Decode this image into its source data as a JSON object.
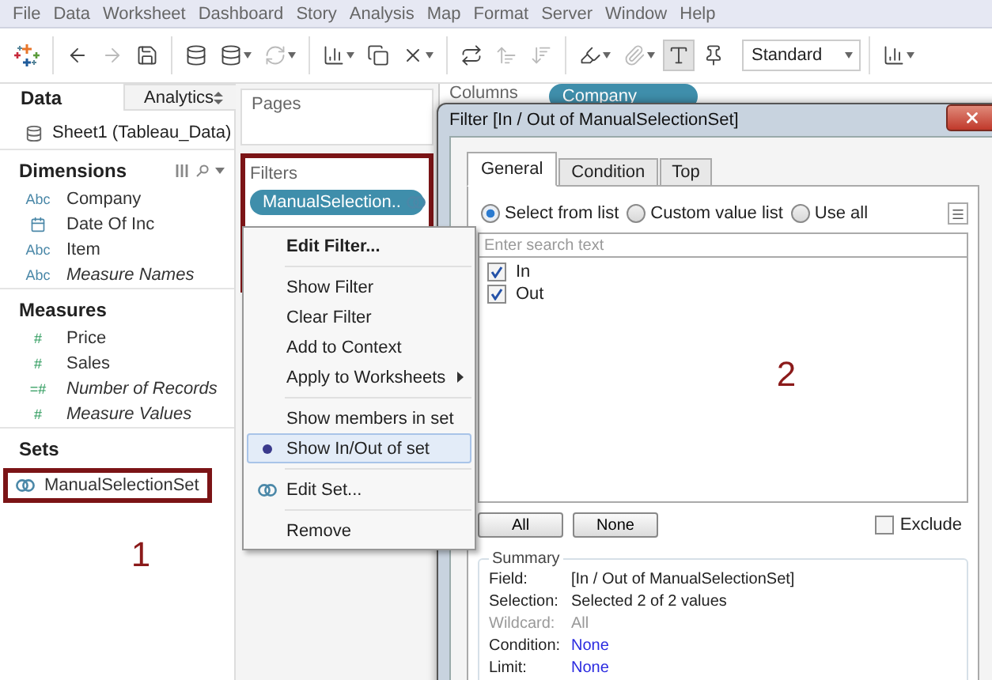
{
  "menu_bar": [
    "File",
    "Data",
    "Worksheet",
    "Dashboard",
    "Story",
    "Analysis",
    "Map",
    "Format",
    "Server",
    "Window",
    "Help"
  ],
  "toolbar": {
    "items": [
      {
        "kind": "logo",
        "disabled": false,
        "selected": false,
        "dropdown": false
      },
      {
        "kind": "separator"
      },
      {
        "kind": "back",
        "disabled": false,
        "selected": false,
        "dropdown": false
      },
      {
        "kind": "forward",
        "disabled": true,
        "selected": false,
        "dropdown": false
      },
      {
        "kind": "save",
        "disabled": false,
        "selected": false,
        "dropdown": false
      },
      {
        "kind": "separator"
      },
      {
        "kind": "new-data-source",
        "disabled": false,
        "selected": false,
        "dropdown": false
      },
      {
        "kind": "pause-updates",
        "disabled": false,
        "selected": false,
        "dropdown": true
      },
      {
        "kind": "refresh",
        "disabled": true,
        "selected": false,
        "dropdown": true
      },
      {
        "kind": "separator"
      },
      {
        "kind": "new-sheet",
        "disabled": false,
        "selected": false,
        "dropdown": true
      },
      {
        "kind": "duplicate",
        "disabled": false,
        "selected": false,
        "dropdown": false
      },
      {
        "kind": "clear-sheet",
        "disabled": false,
        "selected": false,
        "dropdown": true
      },
      {
        "kind": "separator"
      },
      {
        "kind": "swap",
        "disabled": false,
        "selected": false,
        "dropdown": false
      },
      {
        "kind": "sort-ascending",
        "disabled": true,
        "selected": false,
        "dropdown": false
      },
      {
        "kind": "sort-descending",
        "disabled": true,
        "selected": false,
        "dropdown": false
      },
      {
        "kind": "separator"
      },
      {
        "kind": "highlight",
        "disabled": false,
        "selected": false,
        "dropdown": true
      },
      {
        "kind": "annotate",
        "disabled": true,
        "selected": false,
        "dropdown": true
      },
      {
        "kind": "labels",
        "disabled": false,
        "selected": true,
        "dropdown": false
      },
      {
        "kind": "pin",
        "disabled": false,
        "selected": false,
        "dropdown": false
      }
    ],
    "fit": "Standard",
    "show_me_dropdown": true
  },
  "data_pane": {
    "tabs": [
      {
        "label": "Data",
        "selected": true
      },
      {
        "label": "Analytics",
        "selected": false
      }
    ],
    "data_source": "Sheet1 (Tableau_Data)",
    "sections": [
      {
        "title": "Dimensions",
        "fields": [
          {
            "kind": "text",
            "badge": "Abc",
            "name": "Company",
            "generated": false
          },
          {
            "kind": "date",
            "name": "Date Of Inc",
            "generated": false
          },
          {
            "kind": "text",
            "badge": "Abc",
            "name": "Item",
            "generated": false
          },
          {
            "kind": "text",
            "badge": "Abc",
            "name": "Measure Names",
            "generated": true
          }
        ]
      },
      {
        "title": "Measures",
        "fields": [
          {
            "kind": "number",
            "badge": "#",
            "name": "Price",
            "generated": false
          },
          {
            "kind": "number",
            "badge": "#",
            "name": "Sales",
            "generated": false
          },
          {
            "kind": "number",
            "badge": "=#",
            "name": "Number of Records",
            "generated": true
          },
          {
            "kind": "number",
            "badge": "#",
            "name": "Measure Values",
            "generated": true
          }
        ]
      },
      {
        "title": "Sets",
        "fields": [
          {
            "kind": "set",
            "name": "ManualSelectionSet",
            "generated": false,
            "highlighted": true
          }
        ]
      }
    ],
    "annotation": "1"
  },
  "pages_shelf": {
    "title": "Pages"
  },
  "filters_shelf": {
    "title": "Filters",
    "highlighted": true,
    "pills": [
      "ManualSelection.."
    ]
  },
  "columns_shelf": {
    "label": "Columns",
    "pills": [
      "Company"
    ]
  },
  "context_menu": {
    "items": [
      {
        "kind": "item",
        "label": "Edit Filter...",
        "bold": true,
        "checked": false,
        "submenu": false,
        "icon": false
      },
      {
        "kind": "separator"
      },
      {
        "kind": "item",
        "label": "Show Filter",
        "bold": false,
        "checked": false,
        "submenu": false,
        "icon": false
      },
      {
        "kind": "item",
        "label": "Clear Filter",
        "bold": false,
        "checked": false,
        "submenu": false,
        "icon": false
      },
      {
        "kind": "item",
        "label": "Add to Context",
        "bold": false,
        "checked": false,
        "submenu": false,
        "icon": false
      },
      {
        "kind": "item",
        "label": "Apply to Worksheets",
        "bold": false,
        "checked": false,
        "submenu": true,
        "icon": false
      },
      {
        "kind": "separator"
      },
      {
        "kind": "item",
        "label": "Show members in set",
        "bold": false,
        "checked": false,
        "submenu": false,
        "icon": false
      },
      {
        "kind": "item",
        "label": "Show In/Out of set",
        "bold": false,
        "checked": true,
        "submenu": false,
        "icon": false
      },
      {
        "kind": "separator"
      },
      {
        "kind": "item",
        "label": "Edit Set...",
        "bold": false,
        "checked": false,
        "submenu": false,
        "icon": true
      },
      {
        "kind": "separator"
      },
      {
        "kind": "item",
        "label": "Remove",
        "bold": false,
        "checked": false,
        "submenu": false,
        "icon": false
      }
    ]
  },
  "dialog": {
    "title": "Filter [In / Out of ManualSelectionSet]",
    "tabs": [
      {
        "label": "General",
        "selected": true
      },
      {
        "label": "Condition",
        "selected": false
      },
      {
        "label": "Top",
        "selected": false
      }
    ],
    "modes": [
      {
        "label": "Select from list",
        "selected": true
      },
      {
        "label": "Custom value list",
        "selected": false
      },
      {
        "label": "Use all",
        "selected": false
      }
    ],
    "search": {
      "placeholder": "Enter search text"
    },
    "values": [
      {
        "label": "In",
        "checked": true
      },
      {
        "label": "Out",
        "checked": true
      }
    ],
    "annotation": "2",
    "buttons": [
      "All",
      "None"
    ],
    "exclude": {
      "label": "Exclude",
      "checked": false
    },
    "summary": {
      "title": "Summary",
      "rows": [
        {
          "label": "Field:",
          "value": "[In / Out of ManualSelectionSet]",
          "disabled": false,
          "link": false
        },
        {
          "label": "Selection:",
          "value": "Selected 2 of 2 values",
          "disabled": false,
          "link": false
        },
        {
          "label": "Wildcard:",
          "value": "All",
          "disabled": true,
          "link": false
        },
        {
          "label": "Condition:",
          "value": "None",
          "disabled": false,
          "link": true
        },
        {
          "label": "Limit:",
          "value": "None",
          "disabled": false,
          "link": true
        }
      ]
    }
  }
}
